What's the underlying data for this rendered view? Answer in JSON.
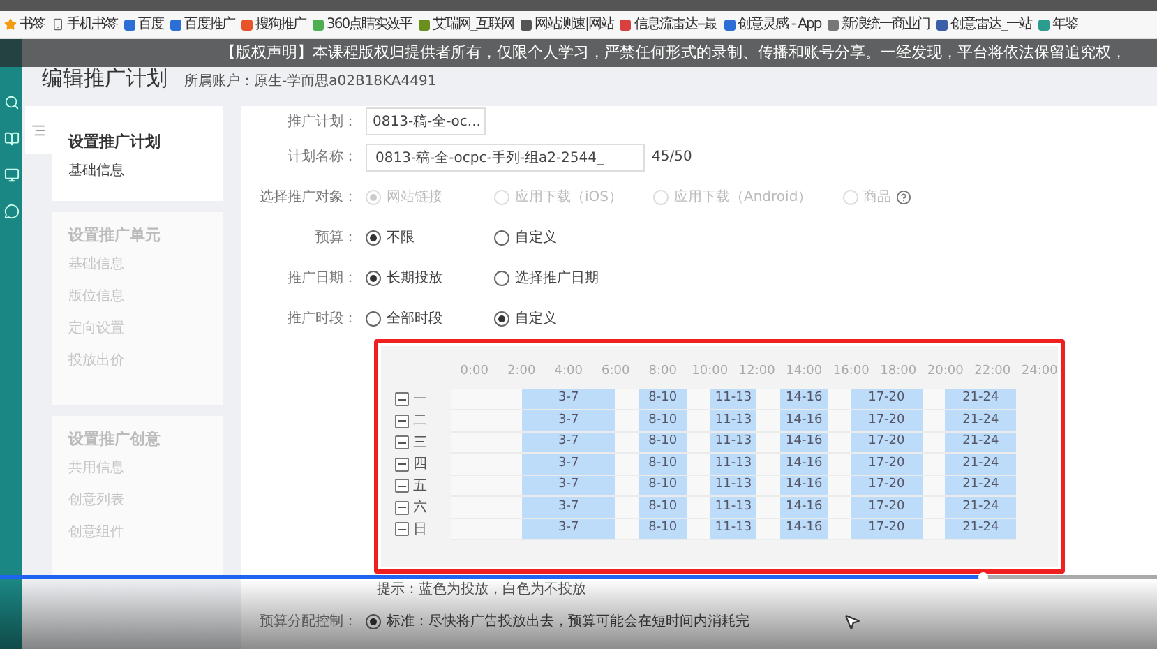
{
  "bookmarks": [
    {
      "label": "书签"
    },
    {
      "label": "手机书签"
    },
    {
      "label": "百度"
    },
    {
      "label": "百度推广"
    },
    {
      "label": "搜狗推广"
    },
    {
      "label": "360点睛实效平"
    },
    {
      "label": "艾瑞网_互联网"
    },
    {
      "label": "网站测速|网站"
    },
    {
      "label": "信息流雷达--最"
    },
    {
      "label": "创意灵感 - App"
    },
    {
      "label": "新浪统一商业门"
    },
    {
      "label": "创意雷达_一站"
    },
    {
      "label": "年鉴"
    }
  ],
  "banner": "【版权声明】本课程版权归提供者所有，仅限个人学习，严禁任何形式的录制、传播和账号分享。一经发现，平台将依法保留追究权，",
  "page": {
    "title": "编辑推广计划",
    "account": "所属账户：原生-学而思a02B18KA4491"
  },
  "nav": [
    {
      "title": "设置推广计划",
      "selected": true,
      "items": [
        {
          "label": "基础信息",
          "selected": true
        }
      ]
    },
    {
      "title": "设置推广单元",
      "selected": false,
      "items": [
        {
          "label": "基础信息",
          "selected": false
        },
        {
          "label": "版位信息",
          "selected": false
        },
        {
          "label": "定向设置",
          "selected": false
        },
        {
          "label": "投放出价",
          "selected": false
        }
      ]
    },
    {
      "title": "设置推广创意",
      "selected": false,
      "items": [
        {
          "label": "共用信息",
          "selected": false
        },
        {
          "label": "创意列表",
          "selected": false
        },
        {
          "label": "创意组件",
          "selected": false
        }
      ]
    }
  ],
  "form": [
    {
      "kind": "select",
      "label": "推广计划：",
      "value": "0813-稿-全-oc..."
    },
    {
      "kind": "input",
      "label": "计划名称：",
      "value": "0813-稿-全-ocpc-手列-组a2-2544_",
      "counter": "45/50"
    },
    {
      "kind": "radio",
      "label": "选择推广对象：",
      "options": [
        {
          "label": "网站链接",
          "selected": true,
          "disabled": true,
          "help": false
        },
        {
          "label": "应用下载（iOS）",
          "selected": false,
          "disabled": true,
          "help": false
        },
        {
          "label": "应用下载（Android）",
          "selected": false,
          "disabled": true,
          "help": false
        },
        {
          "label": "商品",
          "selected": false,
          "disabled": true,
          "help": true
        }
      ]
    },
    {
      "kind": "radio",
      "label": "预算：",
      "options": [
        {
          "label": "不限",
          "selected": true,
          "disabled": false,
          "help": false
        },
        {
          "label": "自定义",
          "selected": false,
          "disabled": false,
          "help": false
        }
      ]
    },
    {
      "kind": "radio",
      "label": "推广日期：",
      "options": [
        {
          "label": "长期投放",
          "selected": true,
          "disabled": false,
          "help": false
        },
        {
          "label": "选择推广日期",
          "selected": false,
          "disabled": false,
          "help": false
        }
      ]
    },
    {
      "kind": "radio",
      "label": "推广时段：",
      "options": [
        {
          "label": "全部时段",
          "selected": false,
          "disabled": false,
          "help": false
        },
        {
          "label": "自定义",
          "selected": true,
          "disabled": false,
          "help": false
        }
      ]
    }
  ],
  "schedule": {
    "hours": [
      "0:00",
      "2:00",
      "4:00",
      "6:00",
      "8:00",
      "10:00",
      "12:00",
      "14:00",
      "16:00",
      "18:00",
      "20:00",
      "22:00",
      "24:00"
    ],
    "days": [
      {
        "label": "一",
        "indeterminate": true,
        "segments": [
          {
            "label": "3-7"
          },
          {
            "label": "8-10"
          },
          {
            "label": "11-13"
          },
          {
            "label": "14-16"
          },
          {
            "label": "17-20"
          },
          {
            "label": "21-24"
          }
        ]
      },
      {
        "label": "二",
        "indeterminate": true,
        "segments": [
          {
            "label": "3-7"
          },
          {
            "label": "8-10"
          },
          {
            "label": "11-13"
          },
          {
            "label": "14-16"
          },
          {
            "label": "17-20"
          },
          {
            "label": "21-24"
          }
        ]
      },
      {
        "label": "三",
        "indeterminate": true,
        "segments": [
          {
            "label": "3-7"
          },
          {
            "label": "8-10"
          },
          {
            "label": "11-13"
          },
          {
            "label": "14-16"
          },
          {
            "label": "17-20"
          },
          {
            "label": "21-24"
          }
        ]
      },
      {
        "label": "四",
        "indeterminate": true,
        "segments": [
          {
            "label": "3-7"
          },
          {
            "label": "8-10"
          },
          {
            "label": "11-13"
          },
          {
            "label": "14-16"
          },
          {
            "label": "17-20"
          },
          {
            "label": "21-24"
          }
        ]
      },
      {
        "label": "五",
        "indeterminate": true,
        "segments": [
          {
            "label": "3-7"
          },
          {
            "label": "8-10"
          },
          {
            "label": "11-13"
          },
          {
            "label": "14-16"
          },
          {
            "label": "17-20"
          },
          {
            "label": "21-24"
          }
        ]
      },
      {
        "label": "六",
        "indeterminate": true,
        "segments": [
          {
            "label": "3-7"
          },
          {
            "label": "8-10"
          },
          {
            "label": "11-13"
          },
          {
            "label": "14-16"
          },
          {
            "label": "17-20"
          },
          {
            "label": "21-24"
          }
        ]
      },
      {
        "label": "日",
        "indeterminate": true,
        "segments": [
          {
            "label": "3-7"
          },
          {
            "label": "8-10"
          },
          {
            "label": "11-13"
          },
          {
            "label": "14-16"
          },
          {
            "label": "17-20"
          },
          {
            "label": "21-24"
          }
        ]
      }
    ],
    "hint": "提示：蓝色为投放，白色为不投放"
  },
  "budget_control": {
    "label": "预算分配控制：",
    "options": [
      {
        "label": "标准：尽快将广告投放出去，预算可能会在短时间内消耗完",
        "selected": true
      }
    ]
  },
  "video": {
    "progress": {
      "level": 0.85
    }
  }
}
